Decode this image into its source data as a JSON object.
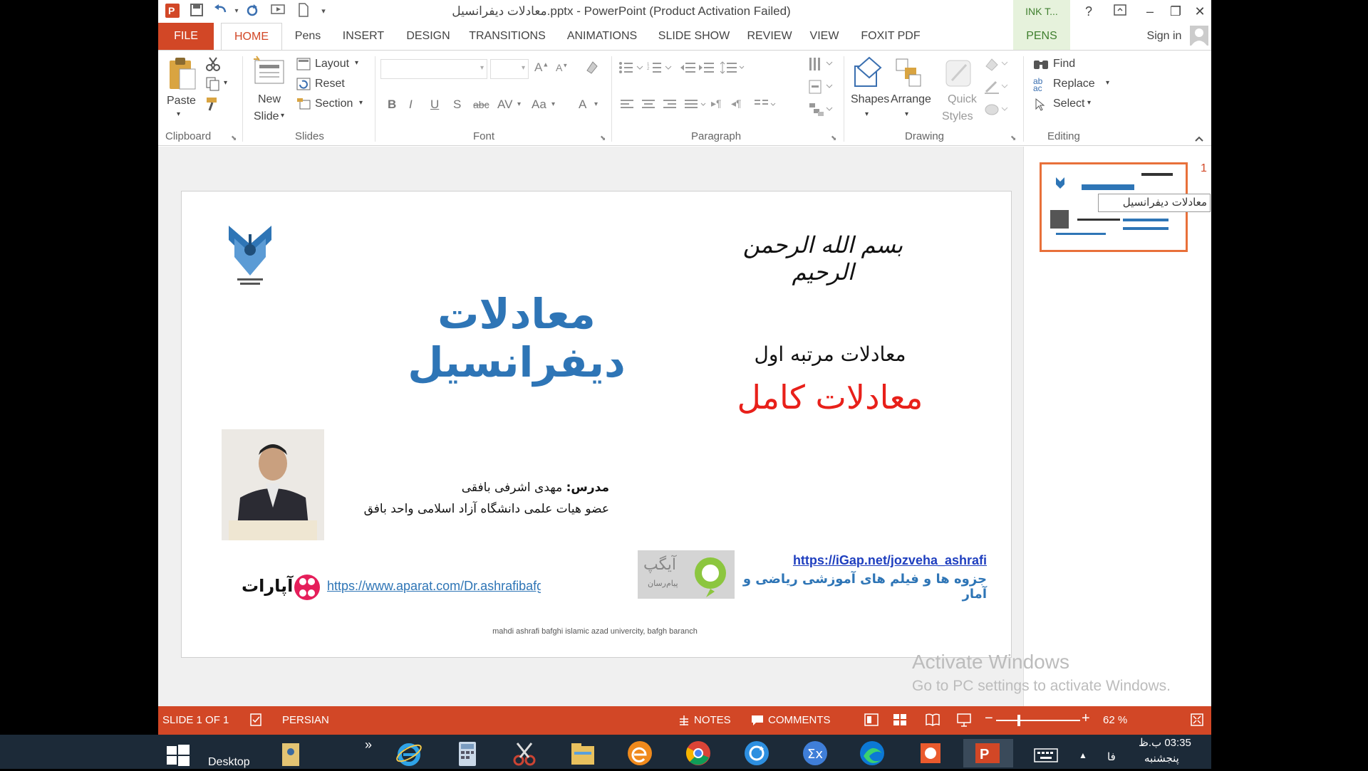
{
  "titlebar": {
    "title": "معادلات دیفرانسیل.pptx - PowerPoint (Product Activation Failed)",
    "ink_tab": "INK T...",
    "help": "?",
    "minimize": "–",
    "restore": "❐",
    "close": "✕"
  },
  "tabs": {
    "file": "FILE",
    "home": "HOME",
    "pens": "Pens",
    "insert": "INSERT",
    "design": "DESIGN",
    "transitions": "TRANSITIONS",
    "animations": "ANIMATIONS",
    "slideshow": "SLIDE SHOW",
    "review": "REVIEW",
    "view": "VIEW",
    "foxit": "FOXIT PDF",
    "pens_tab": "PENS",
    "signin": "Sign in"
  },
  "ribbon": {
    "clipboard": {
      "paste": "Paste",
      "label": "Clipboard"
    },
    "slides": {
      "new_slide_1": "New",
      "new_slide_2": "Slide",
      "layout": "Layout",
      "reset": "Reset",
      "section": "Section",
      "label": "Slides"
    },
    "font": {
      "label": "Font",
      "bold": "B",
      "italic": "I",
      "underline": "U",
      "shadow": "S",
      "strike": "abc",
      "spacing": "AV",
      "case": "Aa",
      "color": "A"
    },
    "paragraph": {
      "label": "Paragraph"
    },
    "drawing": {
      "shapes": "Shapes",
      "arrange": "Arrange",
      "quick_1": "Quick",
      "quick_2": "Styles",
      "label": "Drawing"
    },
    "editing": {
      "find": "Find",
      "replace": "Replace",
      "select": "Select",
      "label": "Editing"
    }
  },
  "slide": {
    "bismillah": "بسم الله الرحمن الرحیم",
    "main_title": "معادلات دیفرانسیل",
    "subtitle1": "معادلات مرتبه اول",
    "subtitle2": "معادلات کامل",
    "teacher_label": "مدرس:",
    "teacher_name": " مهدی اشرفی بافقی",
    "faculty": "عضو هیات علمی دانشگاه آزاد اسلامی واحد بافق",
    "igap_url": "https://iGap.net/jozveha_ashrafi",
    "igap_desc": "جزوه ها و فیلم های آموزشی  ریاضی و آمار",
    "igap_logo_text": "آیگپ",
    "igap_logo_sub": "پیام‌رسان",
    "aparat_url": "https://www.aparat.com/Dr.ashrafibafghi",
    "aparat_logo_text": "آپارات",
    "footer": "mahdi ashrafi bafghi  islamic azad univercity, bafgh baranch"
  },
  "thumbnail": {
    "number": "1",
    "tooltip": "معادلات دیفرانسیل"
  },
  "watermark": {
    "line1": "Activate Windows",
    "line2": "Go to PC settings to activate Windows."
  },
  "status": {
    "slide": "SLIDE 1 OF 1",
    "lang": "PERSIAN",
    "notes": "NOTES",
    "comments": "COMMENTS",
    "zoom": "62 %"
  },
  "taskbar": {
    "desktop": "Desktop",
    "chevron": "»",
    "time": "03:35 ب.ظ",
    "day": "پنجشنبه",
    "lang": "فا"
  },
  "colors": {
    "accent": "#d24726",
    "title_blue": "#2e75b6",
    "red": "#e8201a",
    "link": "#1f3fbf"
  }
}
